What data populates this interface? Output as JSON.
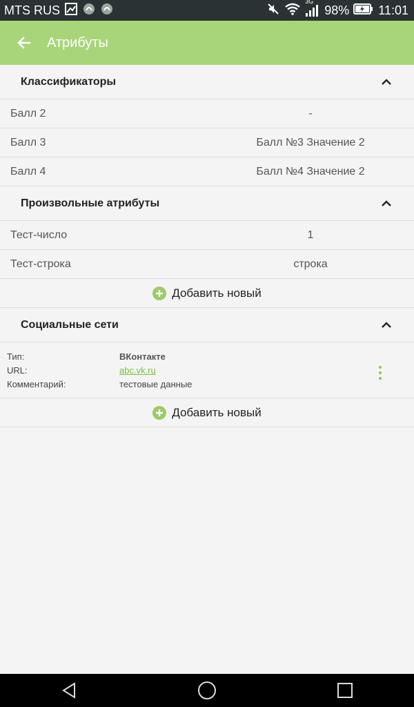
{
  "status_bar": {
    "carrier": "MTS RUS",
    "network": "3G",
    "battery": "98%",
    "time": "11:01"
  },
  "app_bar": {
    "title": "Атрибуты"
  },
  "sections": {
    "classifiers": {
      "title": "Классификаторы",
      "rows": [
        {
          "label": "Балл 2",
          "value": "-"
        },
        {
          "label": "Балл 3",
          "value": "Балл №3 Значение 2"
        },
        {
          "label": "Балл 4",
          "value": "Балл №4 Значение 2"
        }
      ]
    },
    "custom": {
      "title": "Произвольные атрибуты",
      "rows": [
        {
          "label": "Тест-число",
          "value": "1"
        },
        {
          "label": "Тест-строка",
          "value": "строка"
        }
      ],
      "add_label": "Добавить новый"
    },
    "social": {
      "title": "Социальные сети",
      "entry": {
        "type_label": "Тип:",
        "type_value": "ВКонтакте",
        "url_label": "URL:",
        "url_value": "abc.vk.ru",
        "comment_label": "Комментарий:",
        "comment_value": "тестовые данные"
      },
      "add_label": "Добавить новый"
    }
  },
  "colors": {
    "accent": "#a8d57a",
    "link": "#7cbb43",
    "status_bar": "#2a3234"
  }
}
